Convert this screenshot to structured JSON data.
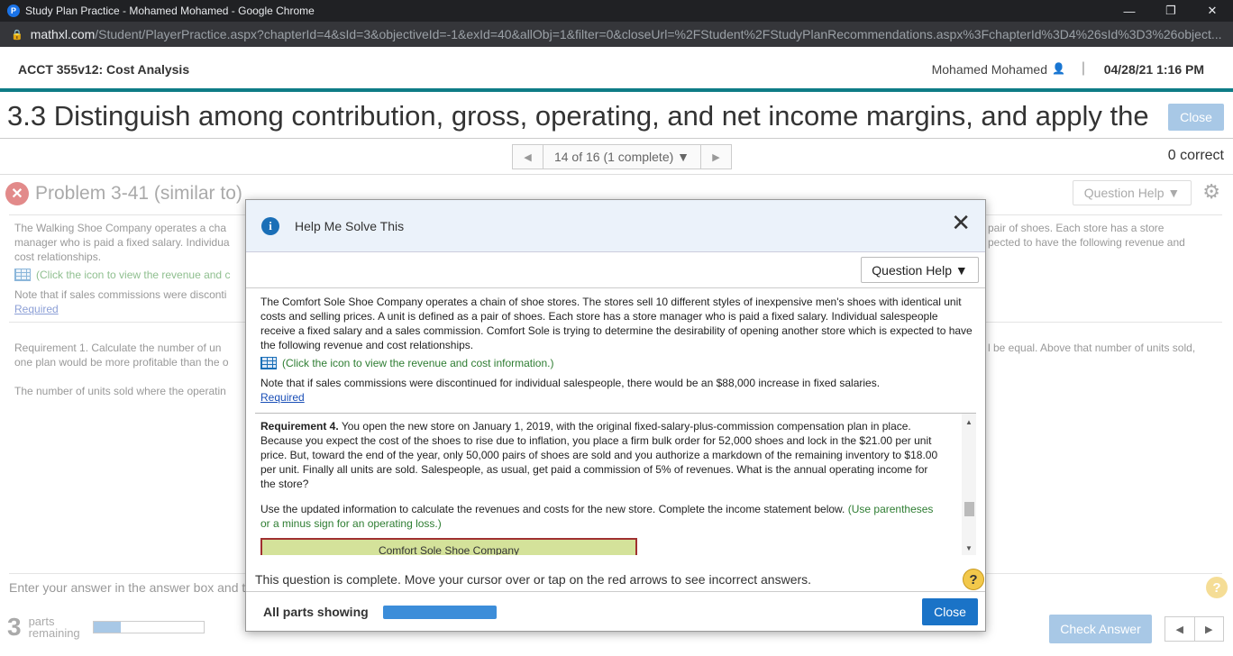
{
  "browser": {
    "tab_title": "Study Plan Practice - Mohamed Mohamed - Google Chrome",
    "favicon_letter": "P",
    "url_host": "mathxl.com",
    "url_path": "/Student/PlayerPractice.aspx?chapterId=4&sId=3&objectiveId=-1&exId=40&allObj=1&filter=0&closeUrl=%2FStudent%2FStudyPlanRecommendations.aspx%3FchapterId%3D4%26sId%3D3%26object...",
    "minimize": "—",
    "restore": "❐",
    "close": "✕"
  },
  "header": {
    "course": "ACCT 355v12: Cost Analysis",
    "user": "Mohamed Mohamed",
    "separator": "|",
    "datetime": "04/28/21 1:16 PM"
  },
  "objective": {
    "title": "3.3 Distinguish among contribution, gross, operating, and net income margins, and apply the",
    "close_label": "Close"
  },
  "nav": {
    "pager_label": "14 of 16 (1 complete) ▼",
    "prev": "◀",
    "next": "▶",
    "score": "0 correct"
  },
  "problem": {
    "title": "Problem 3-41 (similar to)",
    "question_help": "Question Help ▼",
    "bg_line1a": "The Walking Shoe Company operates a cha",
    "bg_line1b": "pair of shoes. Each store has a store",
    "bg_line2a": "manager who is paid a fixed salary. Individua",
    "bg_line2b": "pected to have the following revenue and",
    "bg_line3": "cost relationships.",
    "bg_click": "(Click the icon to view the revenue and c",
    "bg_note": "Note that if sales commissions were disconti",
    "bg_required": "Required",
    "bg_req1a": "Requirement 1.  Calculate the number of un",
    "bg_req1b": "l be equal. Above that number of units sold,",
    "bg_req1c": "one plan would be more profitable than the o",
    "bg_units": "The number of units sold where the operatin",
    "enter_answer": "Enter your answer in the answer box and t",
    "parts_count": "3",
    "parts_label1": "parts",
    "parts_label2": "remaining",
    "parts_progress": 0.25,
    "check_answer": "Check Answer",
    "help_q": "?"
  },
  "modal": {
    "title": "Help Me Solve This",
    "question_help": "Question Help ▼",
    "intro": "The Comfort Sole Shoe Company operates a chain of shoe stores. The stores sell 10 different styles of inexpensive men's shoes with identical unit costs and selling prices. A unit is defined as a pair of shoes. Each store has a store manager who is paid a fixed salary. Individual salespeople receive a fixed salary and a sales commission. Comfort Sole is trying to determine the desirability of opening another store which is expected to have the following revenue and cost relationships.",
    "click_icon": "(Click the icon to view the revenue and cost information.)",
    "note": "Note that if sales commissions were discontinued for individual salespeople, there would be an $88,000 increase in fixed salaries.",
    "required": "Required",
    "req4_label": "Requirement 4.",
    "req4_text": "You open the new store on January 1, 2019, with the original fixed-salary-plus-commission compensation plan in place. Because you expect the cost of the shoes to rise due to inflation, you place a firm bulk order for 52,000 shoes and lock in the $21.00 per unit price. But, toward the end of the year, only 50,000 pairs of shoes are sold and you authorize a markdown of the remaining inventory to $18.00 per unit. Finally all units are sold. Salespeople, as usual, get paid a commission of 5% of revenues. What is the annual operating income for the store?",
    "instruction": "Use the updated information to calculate the revenues and costs for the new store. Complete the income statement below.",
    "instruction_green": "(Use parentheses or a minus sign for an operating loss.)",
    "company_header": "Comfort Sole Shoe Company",
    "complete_msg": "This question is complete. Move your cursor over or tap on the red arrows to see incorrect answers.",
    "help_q": "?",
    "footer_label": "All parts showing",
    "footer_progress": 1.0,
    "close_label": "Close"
  }
}
